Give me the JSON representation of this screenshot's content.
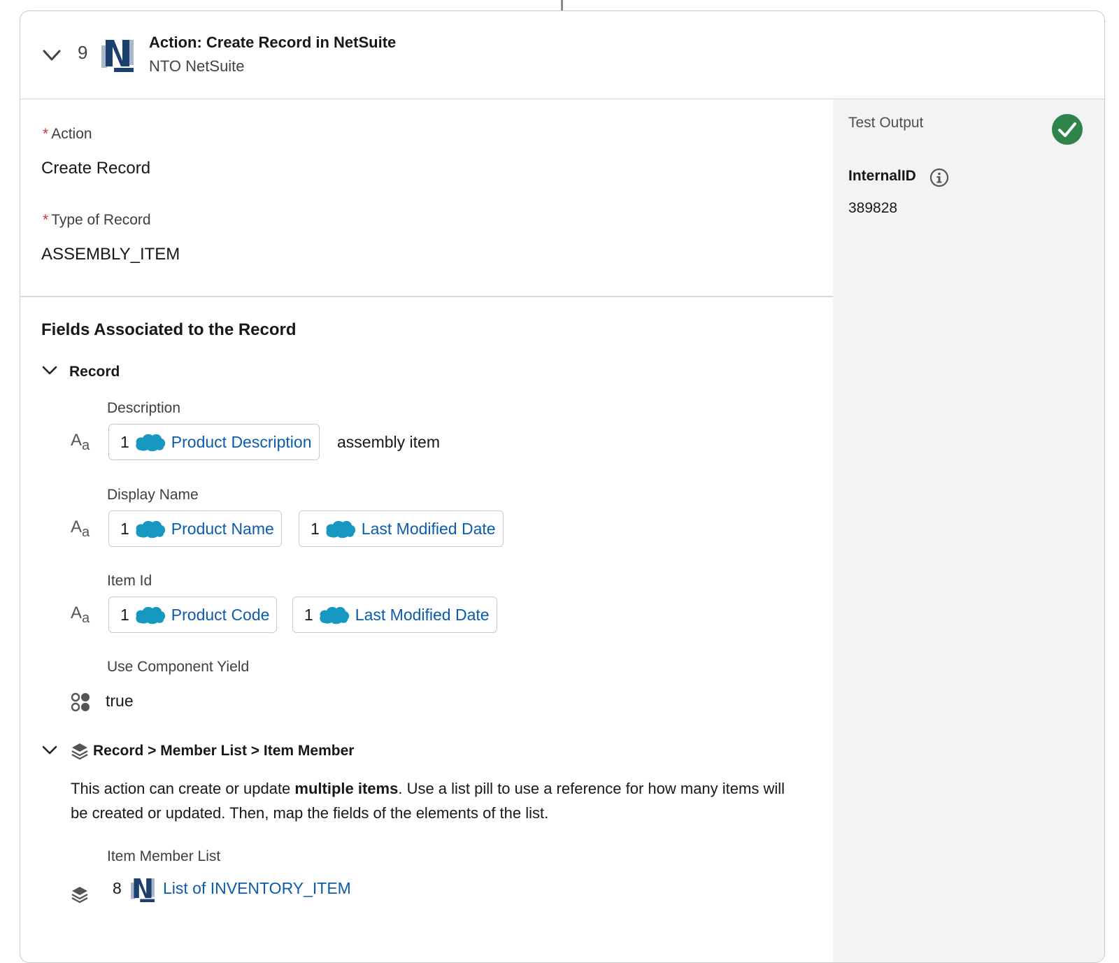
{
  "header": {
    "step_number": "9",
    "title": "Action: Create Record in NetSuite",
    "connection": "NTO NetSuite"
  },
  "config": {
    "action_label": "Action",
    "action_value": "Create Record",
    "record_type_label": "Type of Record",
    "record_type_value": "ASSEMBLY_ITEM"
  },
  "fields": {
    "section_title": "Fields Associated to the Record",
    "record_group": "Record",
    "description": {
      "label": "Description",
      "pill": {
        "step": "1",
        "label": "Product Description"
      },
      "trailing_text": "assembly item"
    },
    "display_name": {
      "label": "Display Name",
      "pills": [
        {
          "step": "1",
          "label": "Product Name"
        },
        {
          "step": "1",
          "label": "Last Modified Date"
        }
      ]
    },
    "item_id": {
      "label": "Item Id",
      "pills": [
        {
          "step": "1",
          "label": "Product Code"
        },
        {
          "step": "1",
          "label": "Last Modified Date"
        }
      ]
    },
    "use_component_yield": {
      "label": "Use Component Yield",
      "value": "true"
    }
  },
  "member_list": {
    "group_title": "Record > Member List > Item Member",
    "description_prefix": "This action can create or update ",
    "description_bold": "multiple items",
    "description_suffix": ". Use a list pill to use a reference for how many items will be created or updated. Then, map the fields of the elements of the list.",
    "list_label": "Item Member List",
    "list_pill": {
      "step": "8",
      "label": "List of INVENTORY_ITEM"
    }
  },
  "test_output": {
    "title": "Test Output",
    "status": "success",
    "field_label": "InternalID",
    "field_value": "389828"
  },
  "colors": {
    "link": "#0b5cab",
    "success": "#2e844a",
    "required": "#c23934",
    "salesforce": "#1798c1",
    "netsuite_dark": "#1b3f6e",
    "netsuite_light": "#a9b7c9"
  }
}
